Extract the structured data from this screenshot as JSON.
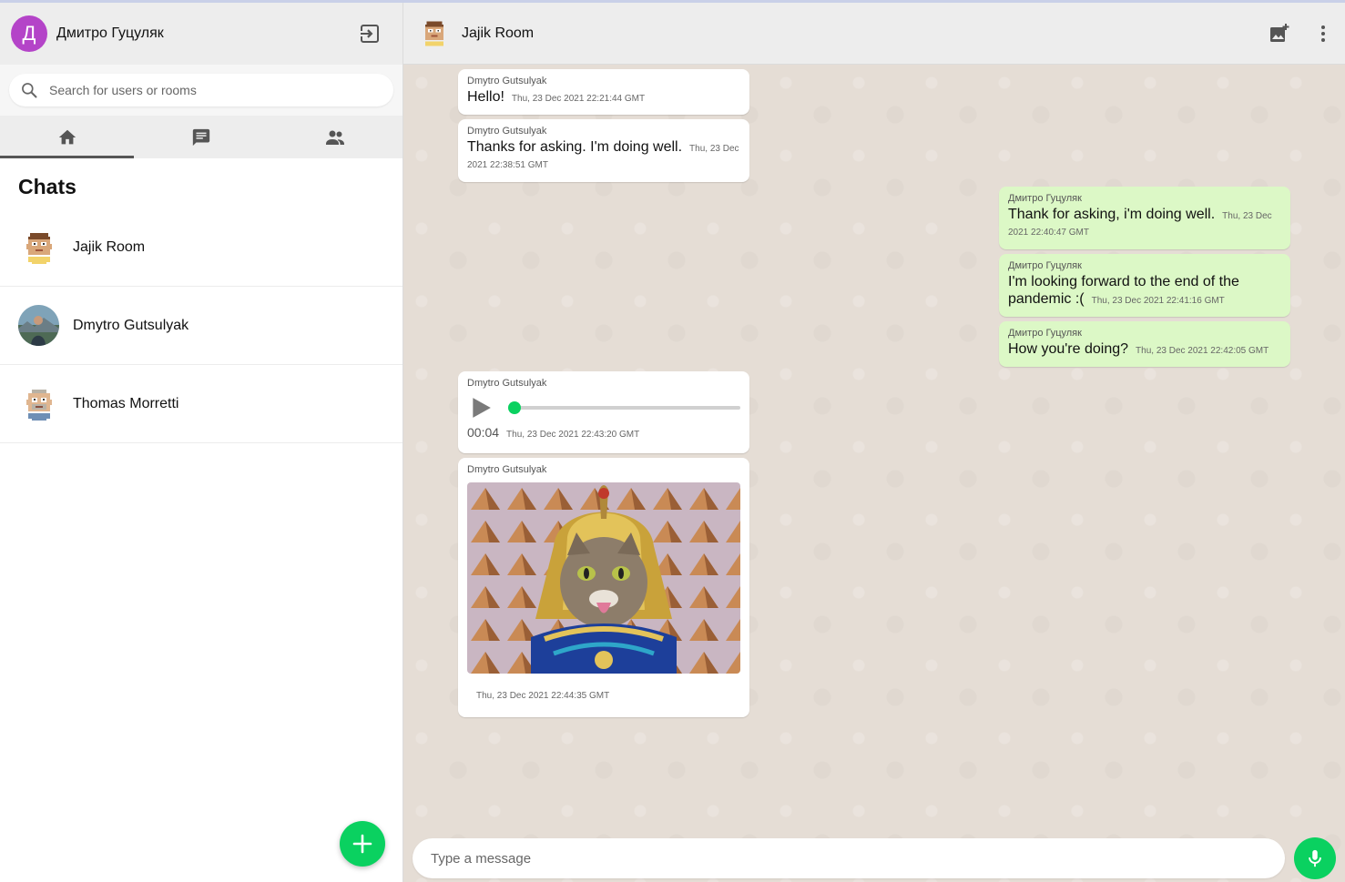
{
  "colors": {
    "accent": "#0ad160",
    "user_avatar": "#b444c8",
    "outgoing_bubble": "#dcf8c6",
    "chat_background": "#e5ddd5"
  },
  "sidebar": {
    "user": {
      "initial": "Д",
      "name": "Дмитро Гуцуляк"
    },
    "logout_icon": "logout-icon",
    "search": {
      "placeholder": "Search for users or rooms"
    },
    "tabs": [
      {
        "icon": "home-icon",
        "active": true
      },
      {
        "icon": "chat-icon",
        "active": false
      },
      {
        "icon": "people-icon",
        "active": false
      }
    ],
    "chats_title": "Chats",
    "chats": [
      {
        "name": "Jajik Room",
        "avatar": "pixel-avatar"
      },
      {
        "name": "Dmytro Gutsulyak",
        "avatar": "photo-avatar"
      },
      {
        "name": "Thomas Morretti",
        "avatar": "pixel-avatar"
      }
    ],
    "new_chat_icon": "plus-icon"
  },
  "chat": {
    "room_title": "Jajik Room",
    "header_icons": [
      "add-photo-icon",
      "more-vert-icon"
    ],
    "messages": [
      {
        "direction": "in",
        "sender": "Dmytro Gutsulyak",
        "text": "Hello!",
        "timestamp": "Thu, 23 Dec 2021 22:21:44 GMT"
      },
      {
        "direction": "in",
        "sender": "Dmytro Gutsulyak",
        "text": "Thanks for asking. I'm doing well.",
        "timestamp_a": "Thu, 23 Dec",
        "timestamp_b": "2021 22:38:51 GMT"
      },
      {
        "direction": "out",
        "sender": "Дмитро Гуцуляк",
        "text": "Thank for asking, i'm doing well.",
        "timestamp_a": "Thu, 23 Dec",
        "timestamp_b": "2021 22:40:47 GMT"
      },
      {
        "direction": "out",
        "sender": "Дмитро Гуцуляк",
        "text_a": "I'm looking forward to the end of the",
        "text_b": "pandemic :(",
        "timestamp": "Thu, 23 Dec 2021 22:41:16 GMT"
      },
      {
        "direction": "out",
        "sender": "Дмитро Гуцуляк",
        "text": "How you're doing?",
        "timestamp": "Thu, 23 Dec 2021 22:42:05 GMT"
      },
      {
        "direction": "in",
        "sender": "Dmytro Gutsulyak",
        "type": "audio",
        "duration": "00:04",
        "progress": 0,
        "timestamp": "Thu, 23 Dec 2021 22:43:20 GMT"
      },
      {
        "direction": "in",
        "sender": "Dmytro Gutsulyak",
        "type": "image",
        "image": "cat-pharaoh-image",
        "timestamp": "Thu, 23 Dec 2021 22:44:35 GMT"
      }
    ],
    "composer": {
      "placeholder": "Type a message"
    },
    "mic_icon": "mic-icon"
  }
}
